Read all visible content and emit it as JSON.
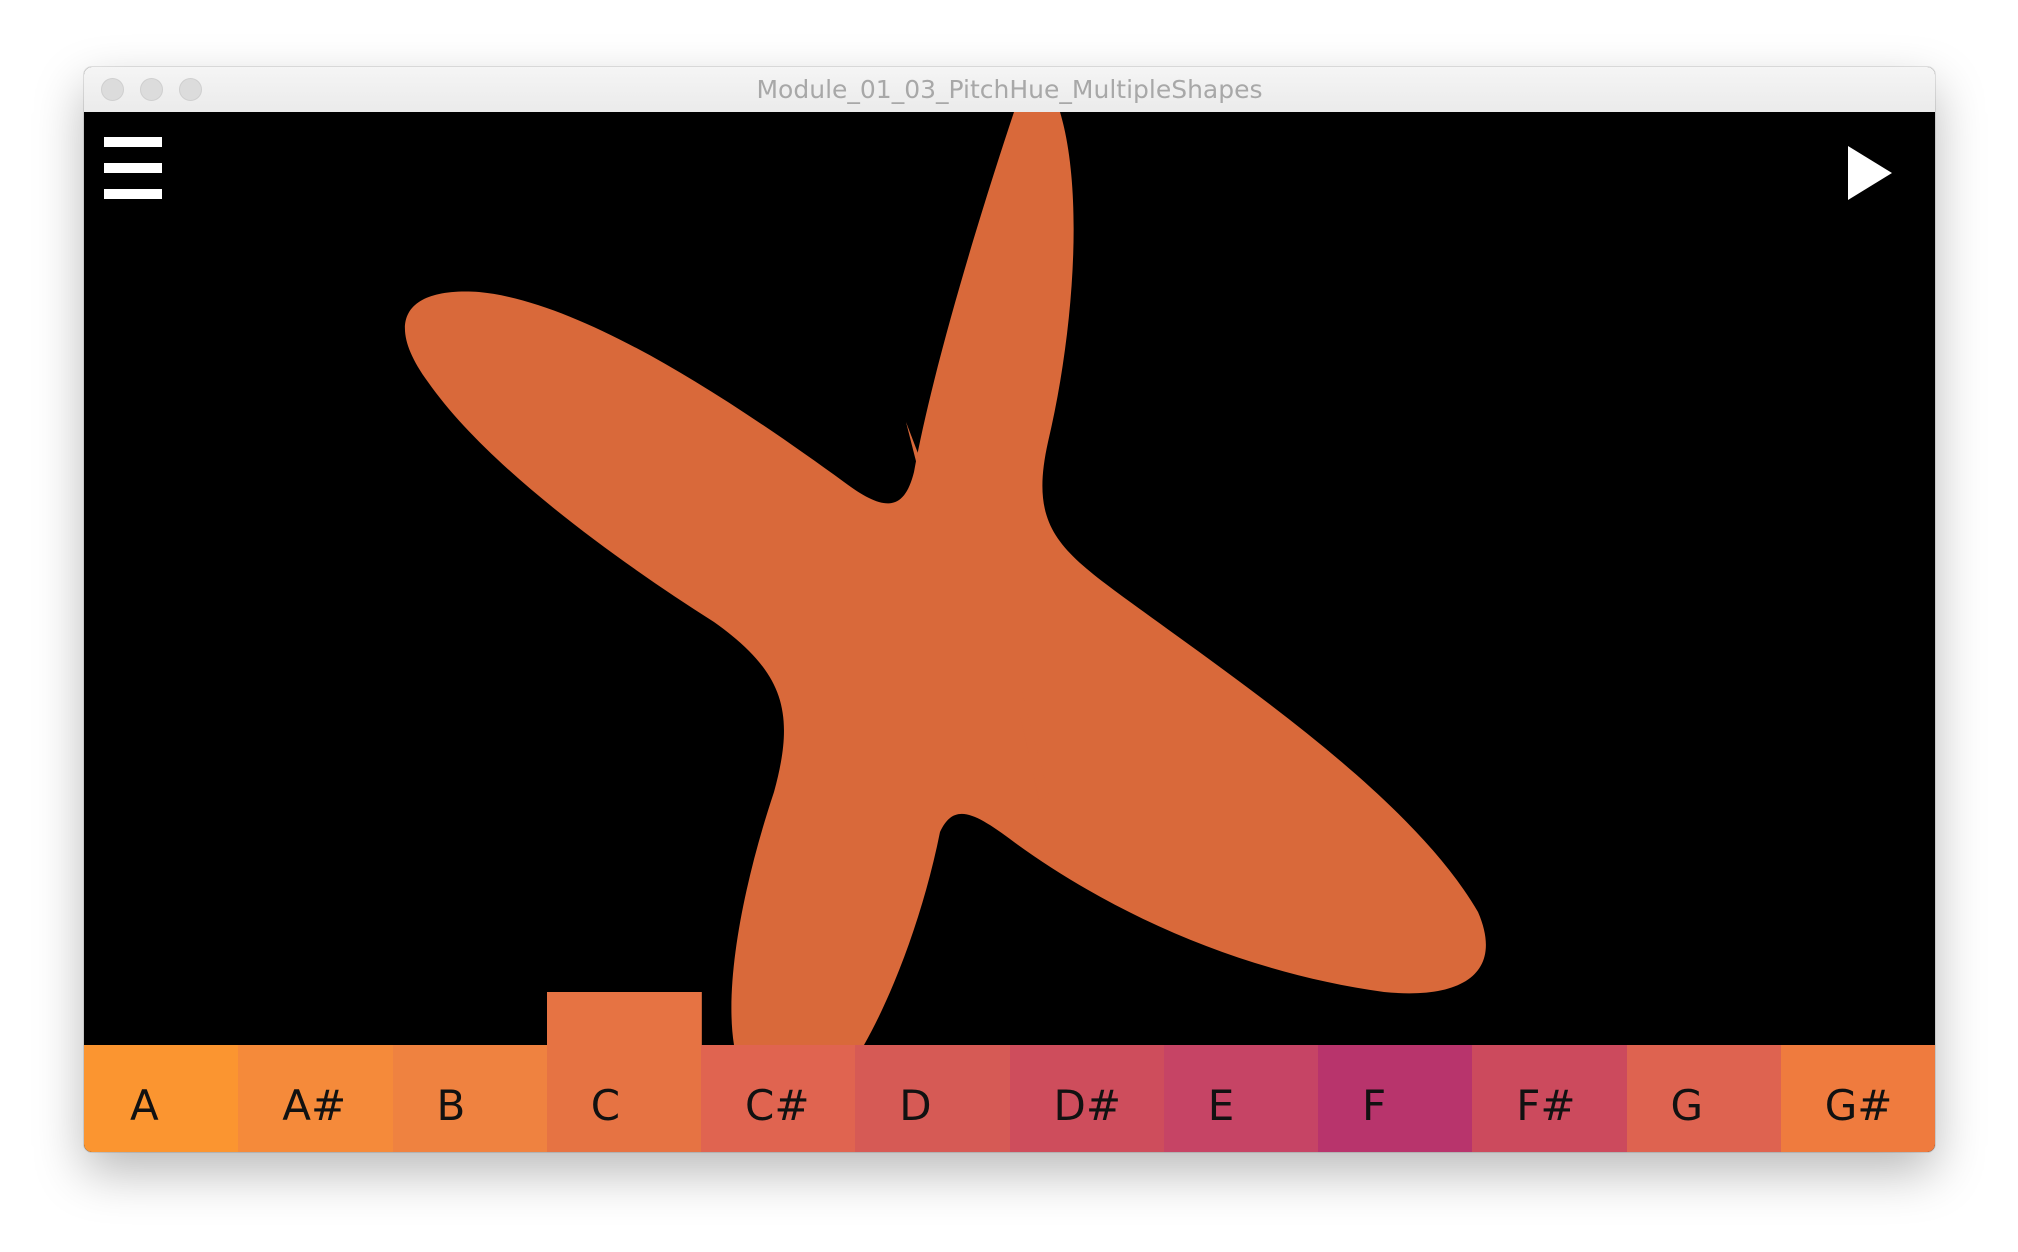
{
  "window": {
    "title": "Module_01_03_PitchHue_MultipleShapes"
  },
  "icons": {
    "menu": "hamburger-menu-icon",
    "play": "play-icon"
  },
  "shape": {
    "color": "#d9693a"
  },
  "keyboard": {
    "active_key": "C",
    "keys": [
      {
        "label": "A",
        "color": "#fb9530"
      },
      {
        "label": "A#",
        "color": "#f58a3a"
      },
      {
        "label": "B",
        "color": "#ef8240"
      },
      {
        "label": "C",
        "color": "#e67343"
      },
      {
        "label": "C#",
        "color": "#e06450"
      },
      {
        "label": "D",
        "color": "#d65a55"
      },
      {
        "label": "D#",
        "color": "#ce4d5c"
      },
      {
        "label": "E",
        "color": "#c64465"
      },
      {
        "label": "F",
        "color": "#b8346c"
      },
      {
        "label": "F#",
        "color": "#cc4a5d"
      },
      {
        "label": "G",
        "color": "#de6350"
      },
      {
        "label": "G#",
        "color": "#ef7b3e"
      }
    ]
  }
}
